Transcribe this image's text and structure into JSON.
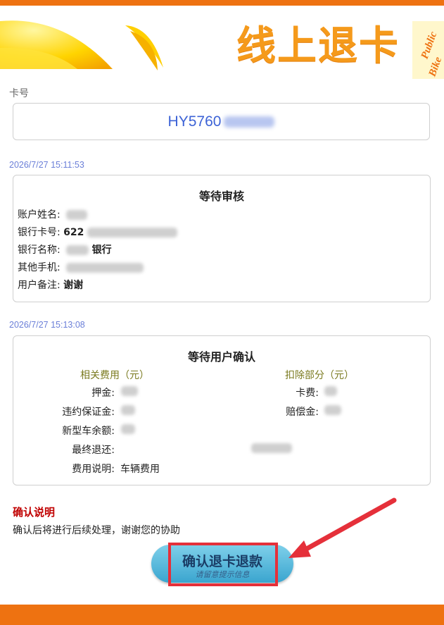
{
  "banner": {
    "title": "线上退卡",
    "logo_text": [
      "Public",
      "Bike"
    ]
  },
  "card": {
    "label": "卡号",
    "number_prefix": "HY5760"
  },
  "review": {
    "timestamp": "2026/7/27 15:11:53",
    "title": "等待审核",
    "rows": [
      {
        "label": "账户姓名:",
        "value": ""
      },
      {
        "label": "银行卡号:",
        "value": "622"
      },
      {
        "label": "银行名称:",
        "value": "银行"
      },
      {
        "label": "其他手机:",
        "value": ""
      },
      {
        "label": "用户备注:",
        "value": "谢谢"
      }
    ]
  },
  "user_confirm": {
    "timestamp": "2026/7/27 15:13:08",
    "title": "等待用户确认",
    "fees_header": "相关费用（元）",
    "deduct_header": "扣除部分（元）",
    "fees": [
      {
        "label": "押金:"
      },
      {
        "label": "违约保证金:"
      },
      {
        "label": "新型车余额:"
      }
    ],
    "deductions": [
      {
        "label": "卡费:"
      },
      {
        "label": "赔偿金:"
      }
    ],
    "final_label": "最终退还:",
    "note_label": "费用说明:",
    "note_value": "车辆费用"
  },
  "confirm": {
    "heading": "确认说明",
    "text": "确认后将进行后续处理，谢谢您的协助",
    "button_label": "确认退卡退款",
    "button_sub": "请留意提示信息"
  },
  "colors": {
    "brand_orange": "#ee7211",
    "accent_red": "#e5303a",
    "link_blue": "#3d63d6"
  }
}
